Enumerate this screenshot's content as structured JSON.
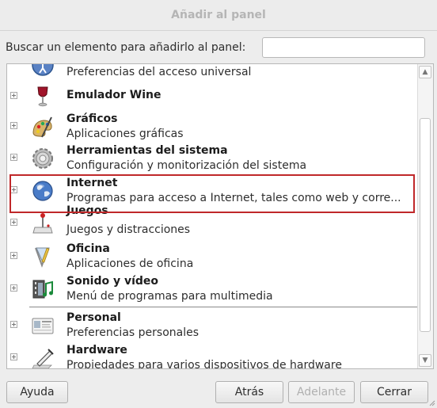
{
  "window": {
    "title": "Añadir al panel"
  },
  "search": {
    "label": "Buscar un elemento para añadirlo al panel:",
    "value": "",
    "placeholder": ""
  },
  "list": {
    "items": [
      {
        "title": "",
        "desc": "Preferencias del acceso universal",
        "icon": "accessibility-icon"
      },
      {
        "title": "Emulador Wine",
        "desc": "",
        "icon": "wine-glass-icon"
      },
      {
        "title": "Gráficos",
        "desc": "Aplicaciones gráficas",
        "icon": "graphics-palette-icon"
      },
      {
        "title": "Herramientas del sistema",
        "desc": "Configuración y monitorización del sistema",
        "icon": "system-gear-icon"
      },
      {
        "title": "Internet",
        "desc": "Programas para acceso a Internet, tales como web y corre...",
        "icon": "globe-icon"
      },
      {
        "title": "Juegos",
        "desc": "Juegos y distracciones",
        "icon": "joystick-icon"
      },
      {
        "title": "Oficina",
        "desc": "Aplicaciones de oficina",
        "icon": "office-icon"
      },
      {
        "title": "Sonido y vídeo",
        "desc": "Menú de programas para multimedia",
        "icon": "multimedia-icon"
      },
      {
        "title": "Personal",
        "desc": "Preferencias personales",
        "icon": "personal-card-icon"
      },
      {
        "title": "Hardware",
        "desc": "Propiedades para varios dispositivos de hardware",
        "icon": "hardware-icon"
      }
    ]
  },
  "buttons": {
    "help": "Ayuda",
    "back": "Atrás",
    "forward": "Adelante",
    "close": "Cerrar"
  },
  "colors": {
    "highlight": "#c0282a"
  }
}
